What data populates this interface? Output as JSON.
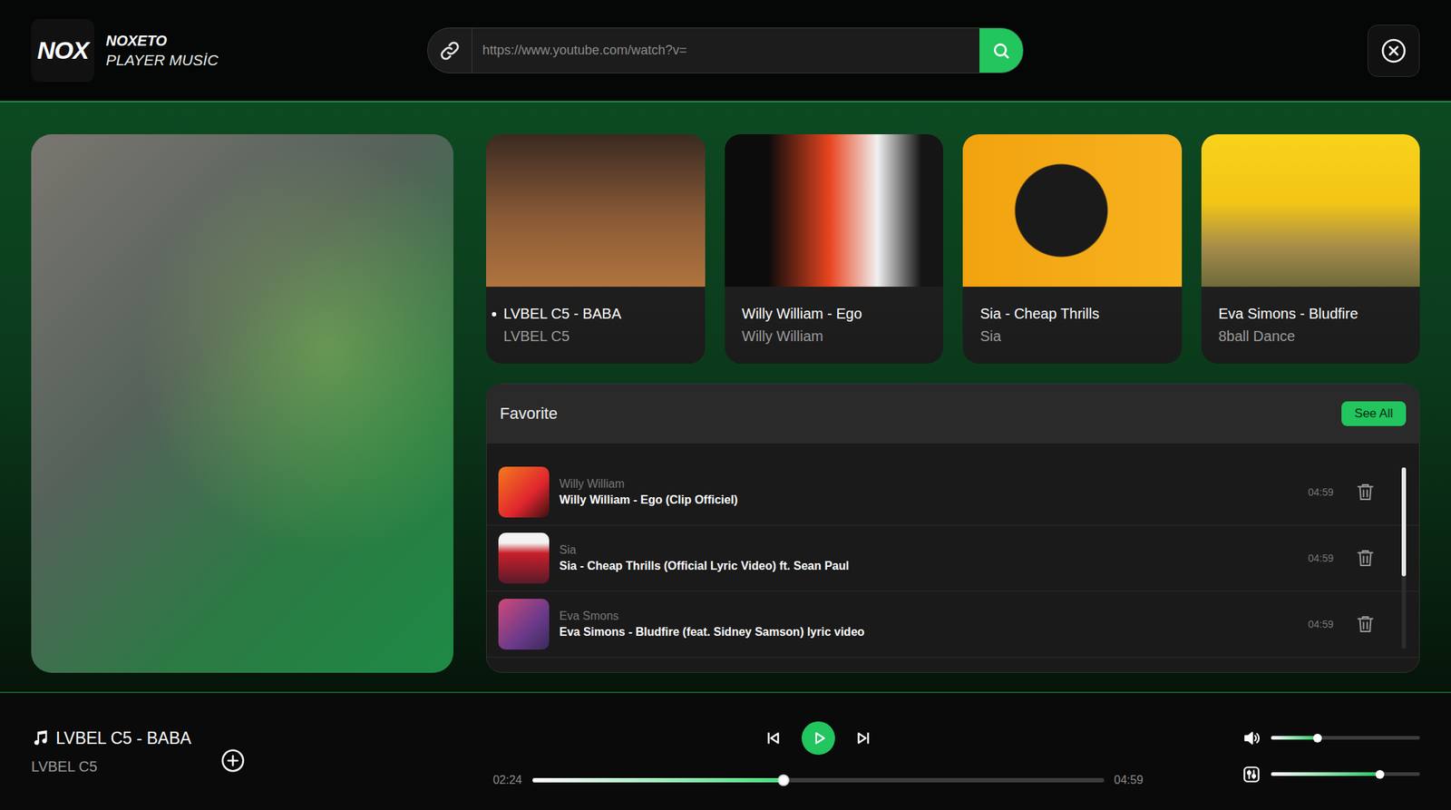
{
  "app": {
    "logo": "NOX",
    "brand": "NOXETO",
    "subtitle": "PLAYER MUSİC"
  },
  "search": {
    "placeholder": "https://www.youtube.com/watch?v="
  },
  "cards": [
    {
      "title": "LVBEL C5 - BABA",
      "artist": "LVBEL C5",
      "playing": true
    },
    {
      "title": "Willy William - Ego",
      "artist": "Willy William",
      "playing": false
    },
    {
      "title": "Sia - Cheap Thrills",
      "artist": "Sia",
      "playing": false
    },
    {
      "title": "Eva Simons - Bludfire",
      "artist": "8ball Dance",
      "playing": false
    }
  ],
  "favorites": {
    "title": "Favorite",
    "see_all": "See All",
    "scroll": {
      "level": 0.6
    },
    "items": [
      {
        "artist": "Willy William",
        "title": "Willy William - Ego (Clip Officiel)",
        "duration": "04:59"
      },
      {
        "artist": "Sia",
        "title": "Sia - Cheap Thrills (Official Lyric Video) ft. Sean Paul",
        "duration": "04:59"
      },
      {
        "artist": "Eva Smons",
        "title": "Eva Simons - Bludfire (feat. Sidney Samson) lyric video",
        "duration": "04:59"
      }
    ]
  },
  "player": {
    "title": "LVBEL C5 - BABA",
    "artist": "LVBEL C5",
    "current": "02:24",
    "total": "04:59",
    "playing": false,
    "progress": {
      "level": 0.44
    },
    "volume": {
      "level": 0.31
    },
    "balance": {
      "level": 0.73
    }
  }
}
